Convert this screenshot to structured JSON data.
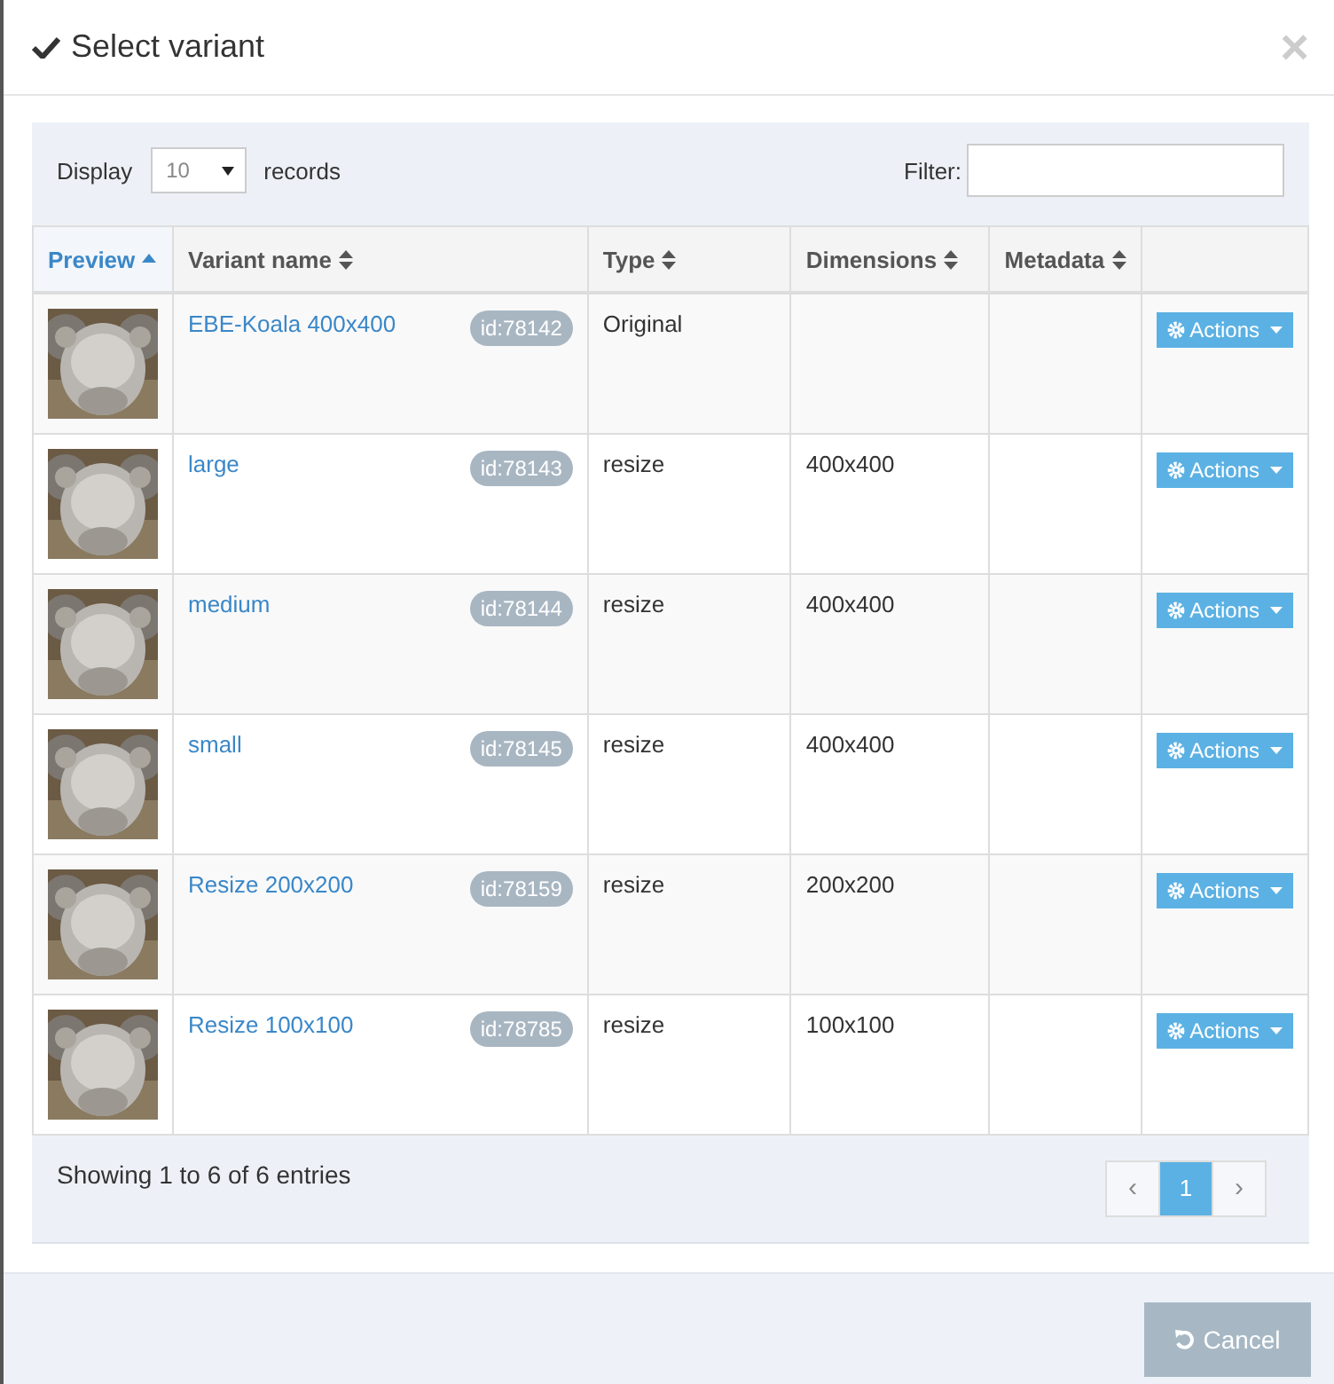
{
  "dialog": {
    "title": "Select variant",
    "close": "×"
  },
  "length": {
    "label_before": "Display",
    "value": "10",
    "label_after": "records"
  },
  "filter": {
    "label": "Filter:"
  },
  "table": {
    "columns": [
      {
        "label": "Preview",
        "sorted": true
      },
      {
        "label": "Variant name",
        "sorted": false
      },
      {
        "label": "Type",
        "sorted": false
      },
      {
        "label": "Dimensions",
        "sorted": false
      },
      {
        "label": "Metadata",
        "sorted": false
      }
    ],
    "rows": [
      {
        "name": "EBE-Koala 400x400",
        "id": "id:78142",
        "type": "Original",
        "dimensions": "",
        "action": "Actions"
      },
      {
        "name": "large",
        "id": "id:78143",
        "type": "resize",
        "dimensions": "400x400",
        "action": "Actions"
      },
      {
        "name": "medium",
        "id": "id:78144",
        "type": "resize",
        "dimensions": "400x400",
        "action": "Actions"
      },
      {
        "name": "small",
        "id": "id:78145",
        "type": "resize",
        "dimensions": "400x400",
        "action": "Actions"
      },
      {
        "name": "Resize 200x200",
        "id": "id:78159",
        "type": "resize",
        "dimensions": "200x200",
        "action": "Actions"
      },
      {
        "name": "Resize 100x100",
        "id": "id:78785",
        "type": "resize",
        "dimensions": "100x100",
        "action": "Actions"
      }
    ]
  },
  "info": "Showing 1 to 6 of 6 entries",
  "pagination": [
    {
      "label": "‹",
      "kind": "prev",
      "selected": false
    },
    {
      "label": "1",
      "kind": "page",
      "selected": true
    },
    {
      "label": "›",
      "kind": "next",
      "selected": false
    }
  ],
  "footer": {
    "cancel": "Cancel",
    "cancel_disabled": true
  }
}
